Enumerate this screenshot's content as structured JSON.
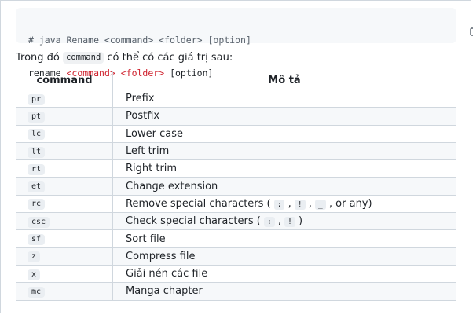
{
  "code_block": {
    "comment": "# java Rename <command> <folder> [option]",
    "keyword": "rename",
    "placeholder_command": "<command>",
    "placeholder_folder": "<folder>",
    "option": "[option]",
    "copy_icon": "copy-icon"
  },
  "paragraph": {
    "before": "Trong đó ",
    "code": "command",
    "after": " có thể có các giá trị sau:"
  },
  "table": {
    "headers": [
      "command",
      "Mô tả"
    ],
    "rows": [
      {
        "command": "pr",
        "description": "Prefix"
      },
      {
        "command": "pt",
        "description": "Postfix"
      },
      {
        "command": "lc",
        "description": "Lower case"
      },
      {
        "command": "lt",
        "description": "Left trim"
      },
      {
        "command": "rt",
        "description": "Right trim"
      },
      {
        "command": "et",
        "description": "Change extension"
      },
      {
        "command": "rc",
        "description": "Remove special characters (",
        "codes": [
          ":",
          "!",
          "_"
        ],
        "separators": [
          ", ",
          ", ",
          ", or any)"
        ]
      },
      {
        "command": "csc",
        "description": "Check special characters (",
        "codes": [
          ":",
          "!"
        ],
        "separators": [
          ", ",
          ")"
        ]
      },
      {
        "command": "sf",
        "description": "Sort file"
      },
      {
        "command": "z",
        "description": "Compress file"
      },
      {
        "command": "x",
        "description": "Giải nén các file"
      },
      {
        "command": "mc",
        "description": "Manga chapter"
      }
    ]
  }
}
